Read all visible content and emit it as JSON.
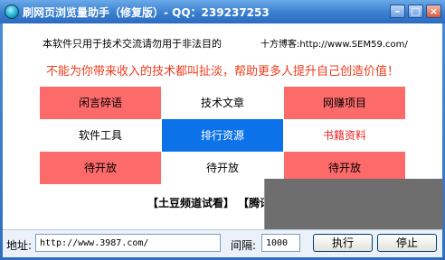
{
  "window": {
    "title": "刷网页浏览量助手（修复版）- QQ：239237253",
    "minimize_glyph": "–",
    "maximize_glyph": "□",
    "close_glyph": "×"
  },
  "notice": {
    "left": "本软件只用于技术交流请勿用于非法目的",
    "right": "十方博客:http://www.SEM59.com/"
  },
  "slogan": "不能为你带来收入的技术都叫扯淡，帮助更多人提升自己创造价值！",
  "grid": [
    [
      "闲言碎语",
      "技术文章",
      "网赚项目"
    ],
    [
      "软件工具",
      "排行资源",
      "书籍资料"
    ],
    [
      "待开放",
      "待开放",
      "待开放"
    ]
  ],
  "links": "【土豆频道试看】 【腾讯频",
  "footer": {
    "address_label": "地址:",
    "address_value": "http://www.3987.com/",
    "interval_label": "间隔:",
    "interval_value": "1000",
    "run_label": "执行",
    "stop_label": "停止"
  },
  "colors": {
    "red": "#fd6a6a",
    "blue": "#0c72ea",
    "slogan": "#ee3b1b",
    "title_bar": "#3a7fd0"
  }
}
